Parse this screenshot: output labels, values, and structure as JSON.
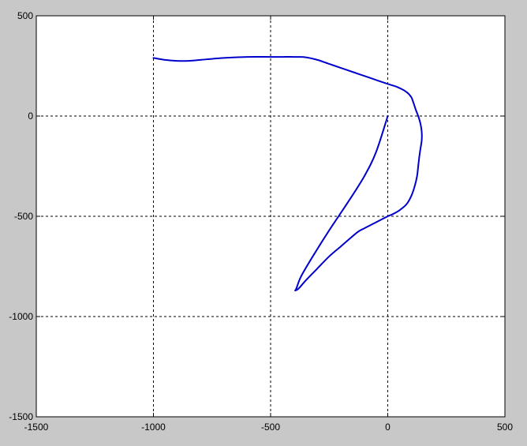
{
  "chart_data": {
    "type": "line",
    "title": "",
    "xlabel": "",
    "ylabel": "",
    "xlim": [
      -1500,
      500
    ],
    "ylim": [
      -1500,
      500
    ],
    "xticks": [
      -1500,
      -1000,
      -500,
      0,
      500
    ],
    "yticks": [
      -1500,
      -1000,
      -500,
      0,
      500
    ],
    "xtick_labels": [
      "-1500",
      "-1000",
      "-500",
      "0",
      "500"
    ],
    "ytick_labels": [
      "-1500",
      "-1000",
      "-500",
      "0",
      "500"
    ],
    "grid": true,
    "grid_style": "dotted",
    "series": [
      {
        "color": "#0000cc",
        "x": [
          -1000,
          -950,
          -900,
          -850,
          -800,
          -700,
          -600,
          -500,
          -450,
          -400,
          -350,
          -300,
          -250,
          -200,
          -150,
          -100,
          -50,
          0,
          40,
          80,
          100,
          110,
          120,
          130,
          140,
          145,
          145,
          140,
          135,
          130,
          125,
          115,
          100,
          80,
          50,
          20,
          0,
          -50,
          -100,
          -130,
          -200,
          -250,
          -300,
          -350,
          -380,
          -395,
          -390,
          -370,
          -320,
          -250,
          -170,
          -100,
          -50,
          0
        ],
        "y": [
          290,
          280,
          275,
          275,
          280,
          290,
          295,
          295,
          295,
          295,
          293,
          280,
          260,
          240,
          220,
          200,
          180,
          160,
          145,
          120,
          95,
          65,
          30,
          0,
          -40,
          -80,
          -120,
          -160,
          -200,
          -250,
          -300,
          -350,
          -400,
          -440,
          -470,
          -490,
          -500,
          -530,
          -560,
          -580,
          -650,
          -700,
          -760,
          -820,
          -860,
          -870,
          -860,
          -800,
          -700,
          -570,
          -430,
          -300,
          -180,
          0
        ]
      }
    ]
  }
}
